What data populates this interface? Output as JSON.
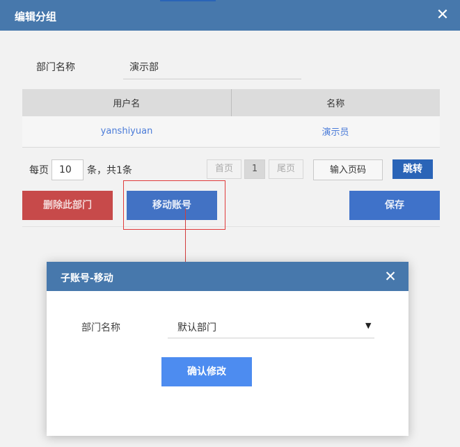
{
  "dialog": {
    "title": "编辑分组",
    "close_glyph": "✕"
  },
  "form": {
    "dept_label": "部门名称",
    "dept_value": "演示部"
  },
  "table": {
    "columns": [
      "用户名",
      "名称"
    ],
    "rows": [
      [
        "yanshiyuan",
        "演示员"
      ]
    ]
  },
  "pagination": {
    "per_page_label": "每页",
    "per_page_value": "10",
    "summary": "条，共1条",
    "first": "首页",
    "current_page": "1",
    "last": "尾页",
    "goto_placeholder": "输入页码",
    "goto_button": "跳转"
  },
  "actions": {
    "delete": "删除此部门",
    "move": "移动账号",
    "save": "保存"
  },
  "modal": {
    "title": "子账号-移动",
    "close_glyph": "✕",
    "dept_label": "部门名称",
    "dept_selected": "默认部门",
    "caret": "▼",
    "confirm": "确认修改"
  },
  "colors": {
    "header": "#4778ac",
    "primary": "#4272c4",
    "danger": "#c74a4a",
    "link": "#4a7bd8",
    "annotation": "#e03a3a"
  }
}
